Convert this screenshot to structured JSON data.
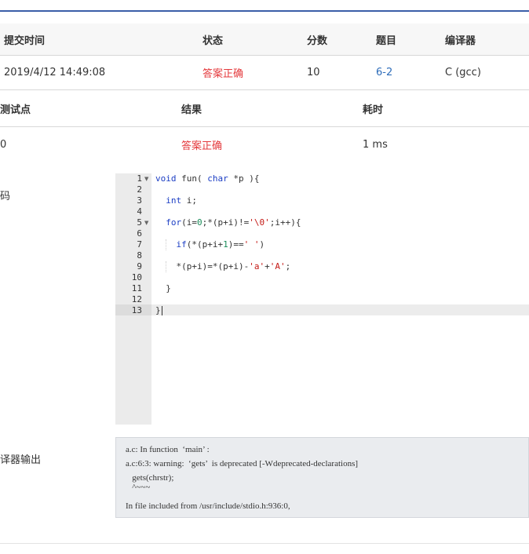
{
  "submission": {
    "headers": {
      "time": "提交时间",
      "status": "状态",
      "score": "分数",
      "problem": "题目",
      "compiler": "编译器"
    },
    "row": {
      "time": "2019/4/12 14:49:08",
      "status": "答案正确",
      "score": "10",
      "problem": "6-2",
      "compiler": "C (gcc)"
    }
  },
  "tests": {
    "headers": {
      "case": "测试点",
      "result": "结果",
      "time": "耗时"
    },
    "row": {
      "case": "0",
      "result": "答案正确",
      "time": "1 ms"
    }
  },
  "labels": {
    "code": "码",
    "compiler_output": "译器输出"
  },
  "code": {
    "line_numbers": [
      "1",
      "2",
      "3",
      "4",
      "5",
      "6",
      "7",
      "8",
      "9",
      "10",
      "11",
      "12",
      "13"
    ]
  },
  "compiler_output": {
    "lines": [
      "a.c: In function  ‘main’ :",
      "a.c:6:3: warning:  ‘gets’  is deprecated [-Wdeprecated-declarations]",
      "   gets(chrstr);",
      "   ^~~~",
      "In file included from /usr/include/stdio.h:936:0,"
    ]
  },
  "colors": {
    "accent": "#3a5ea8",
    "status_ok": "#e4393c",
    "link": "#2e6dba"
  }
}
